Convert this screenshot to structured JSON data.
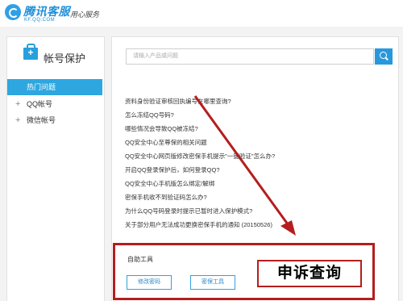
{
  "header": {
    "logo_text": "腾讯客服",
    "logo_sub": "KF.QQ.COM",
    "slogan": "用心服务"
  },
  "sidebar": {
    "title": "帐号保护",
    "items": [
      {
        "label": "热门问题",
        "active": true
      },
      {
        "label": "QQ帐号",
        "active": false
      },
      {
        "label": "微信帐号",
        "active": false
      }
    ]
  },
  "search": {
    "placeholder": "请输入产品或问题"
  },
  "questions": [
    "资料身份验证审核回执编号在哪里查询?",
    "怎么冻结QQ号码?",
    "哪些情况会导致QQ被冻结?",
    "QQ安全中心至尊保的相关问题",
    "QQ安全中心网页版修改密保手机提示\"一键验证\"怎么办?",
    "开启QQ登录保护后，如何登录QQ?",
    "QQ安全中心手机版怎么绑定/解绑",
    "密保手机收不到验证码怎么办?",
    "为什么QQ号码登录时提示已暂时进入保护模式?",
    "关于部分用户无法成功更换密保手机的通知 (20150526)"
  ],
  "tools": {
    "title": "自助工具",
    "buttons": [
      "修改密码",
      "密保工具"
    ]
  },
  "annotation": {
    "label": "申诉查询",
    "color": "#b41e1e"
  }
}
